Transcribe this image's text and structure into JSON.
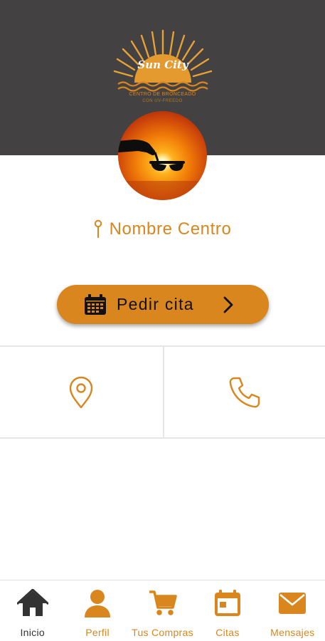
{
  "brand": {
    "logo_script": "Sun City",
    "logo_line1": "CENTRO DE BRONCEADO",
    "logo_line2": "CON UV-FREEDO",
    "colors": {
      "header": "#444142",
      "accent": "#d8861d",
      "nav_active": "#333333"
    }
  },
  "profile": {
    "avatar": "sunset-sunglasses-image",
    "location_icon": "map-pin-icon",
    "center_name": "Nombre Centro"
  },
  "actions": {
    "book_label": "Pedir cita",
    "book_icon": "calendar-icon",
    "book_chevron": "chevron-right-icon"
  },
  "contact": {
    "location_icon": "location-pin-icon",
    "phone_icon": "phone-icon"
  },
  "nav": {
    "items": [
      {
        "label": "Inicio",
        "icon": "home-icon",
        "active": true
      },
      {
        "label": "Perfil",
        "icon": "user-icon",
        "active": false
      },
      {
        "label": "Tus Compras",
        "icon": "cart-icon",
        "active": false
      },
      {
        "label": "Citas",
        "icon": "calendar-icon",
        "active": false
      },
      {
        "label": "Mensajes",
        "icon": "envelope-icon",
        "active": false
      }
    ]
  }
}
